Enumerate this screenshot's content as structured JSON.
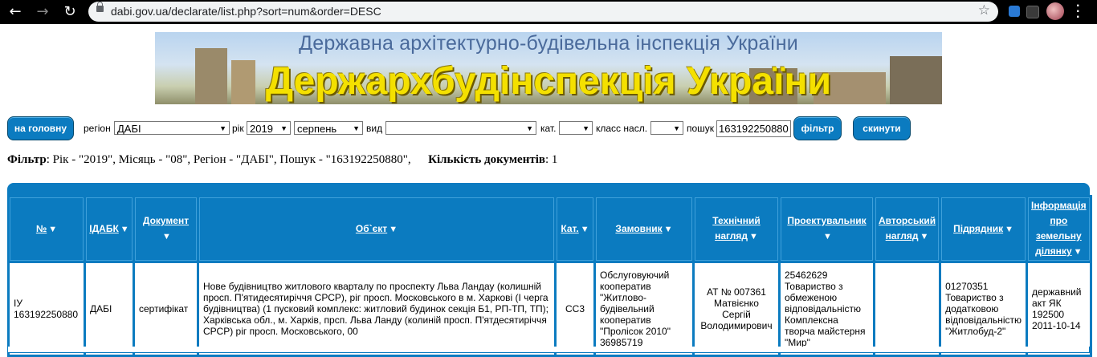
{
  "browser": {
    "url": "dabi.gov.ua/declarate/list.php?sort=num&order=DESC"
  },
  "banner": {
    "subtitle": "Державна архітектурно-будівельна інспекція України",
    "title": "Держархбудінспекція України"
  },
  "filters": {
    "home_button": "на головну",
    "region_label": "регіон",
    "region_value": "ДАБІ",
    "year_label": "рік",
    "year_value": "2019",
    "month_value": "серпень",
    "type_label": "вид",
    "type_value": "",
    "category_label": "кат.",
    "category_value": "",
    "class_label": "класс насл.",
    "class_value": "",
    "search_label": "пошук",
    "search_value": "163192250880",
    "filter_button": "фільтр",
    "reset_button": "скинути"
  },
  "summary": {
    "filter_label": "Фільтр",
    "filter_text": ": Рік - \"2019\", Місяць - \"08\", Регіон - \"ДАБІ\", Пошук - \"163192250880\",",
    "count_label": "Кількість документів",
    "count_text": ": 1"
  },
  "table": {
    "headers": {
      "num": "№",
      "idabk": "ІДАБК",
      "document": "Документ",
      "object": "Об`єкт",
      "category": "Кат.",
      "customer": "Замовник",
      "tech_supervision": "Технічний нагляд",
      "designer": "Проектувальник",
      "author_supervision": "Авторський нагляд",
      "contractor": "Підрядник",
      "land_info": "Інформація про земельну ділянку"
    },
    "rows": [
      {
        "num": "ІУ 163192250880",
        "idabk": "ДАБІ",
        "document": "сертифікат",
        "object": "Нове будівництво житлового кварталу по проспекту Льва Ландау (колишній просп. П'ятидесятиріччя СРСР), ріг просп. Московського в м. Харкові (І черга будівництва) (1 пусковий комплекс: житловий будинок секція Б1, РП-ТП, ТП); Харківська обл., м. Харків, прсп. Льва Ланду (колиній просп. П'ятдесятиріччя СРСР) ріг просп. Московського, 00",
        "category": "СС3",
        "customer": "Обслуговуючий кооператив \"Житлово-будівельний кооператив \"Пролісок 2010\" 36985719",
        "tech_supervision": "АТ № 007361 Матвієнко Сергій Володимирович",
        "designer": "25462629 Товариство з обмеженою відповідальністю Комплексна творча майстерня \"Мир\"",
        "author_supervision": "",
        "contractor": "01270351 Товариство з додатковою відповідальністю \"Житлобуд-2\"",
        "land_info": "державний акт ЯК 192500 2011-10-14"
      }
    ]
  }
}
